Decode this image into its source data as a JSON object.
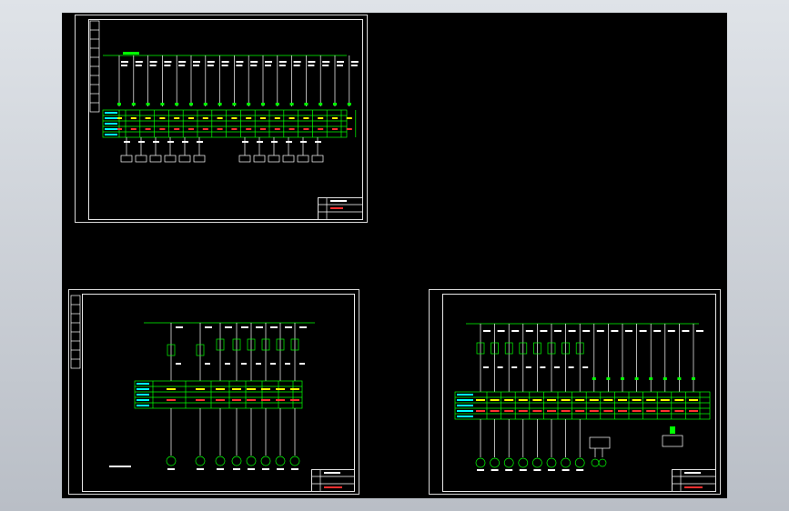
{
  "app": {
    "background": "#c8ccd2",
    "canvas_color": "#000000"
  },
  "colors": {
    "sheet_border": "#d9d9d9",
    "wire_green": "#00ff00",
    "line_white": "#ffffff",
    "text_red": "#ff3030",
    "text_cyan": "#00ffff",
    "text_yellow": "#ffff00"
  },
  "sheets": [
    {
      "id": "sheet-1",
      "title_block": {
        "line1": "",
        "line2": ""
      }
    },
    {
      "id": "sheet-2",
      "title_block": {
        "line1": "",
        "line2": ""
      }
    },
    {
      "id": "sheet-3",
      "title_block": {
        "line1": "",
        "line2": ""
      }
    }
  ]
}
